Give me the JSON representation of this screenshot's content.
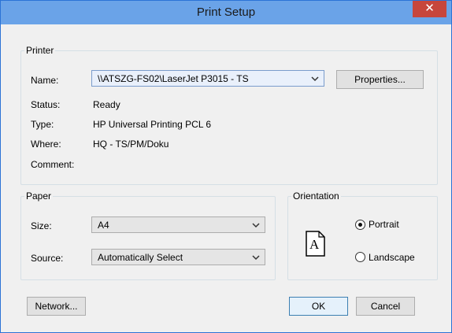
{
  "window": {
    "title": "Print Setup",
    "close_glyph": "✕"
  },
  "printer": {
    "legend": "Printer",
    "name_label": "Name:",
    "name_value": "\\\\ATSZG-FS02\\LaserJet P3015 - TS",
    "properties_button": "Properties...",
    "status_label": "Status:",
    "status_value": "Ready",
    "type_label": "Type:",
    "type_value": "HP Universal Printing PCL 6",
    "where_label": "Where:",
    "where_value": "HQ - TS/PM/Doku",
    "comment_label": "Comment:",
    "comment_value": ""
  },
  "paper": {
    "legend": "Paper",
    "size_label": "Size:",
    "size_value": "A4",
    "source_label": "Source:",
    "source_value": "Automatically Select"
  },
  "orientation": {
    "legend": "Orientation",
    "preview_letter": "A",
    "portrait_label": "Portrait",
    "landscape_label": "Landscape",
    "selected": "portrait"
  },
  "buttons": {
    "network": "Network...",
    "ok": "OK",
    "cancel": "Cancel"
  },
  "icons": {
    "dropdown": "chevron-down-icon",
    "close": "close-icon",
    "page": "portrait-page-icon"
  },
  "colors": {
    "titlebar": "#6aa3e8",
    "close": "#c7463c",
    "focus_border": "#7a9ccc"
  }
}
